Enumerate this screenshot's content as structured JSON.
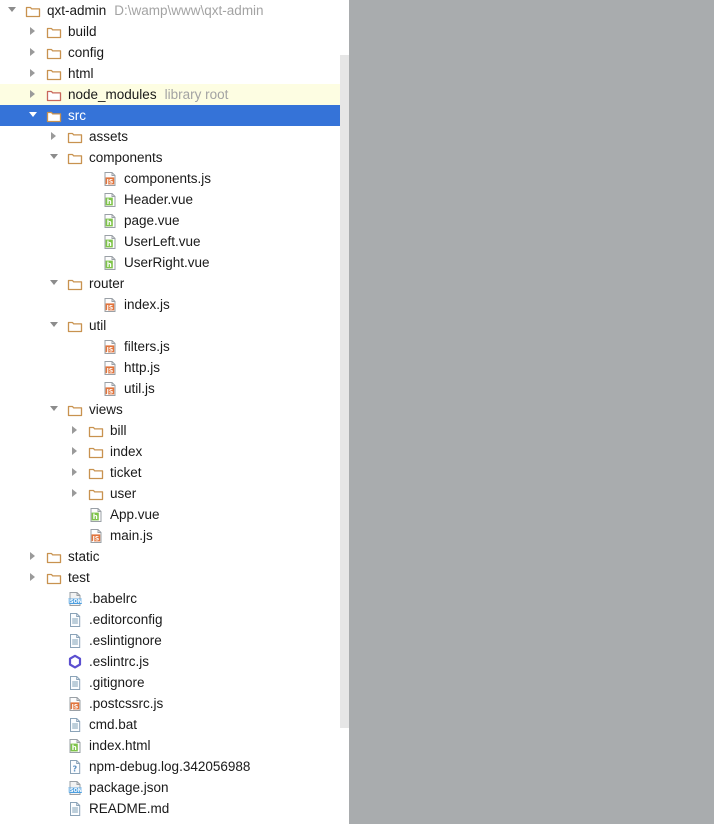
{
  "window": {
    "tool_window": "Project",
    "right_panel_color": "#a9acae",
    "selection_color": "#3573d8",
    "excluded_highlight_color": "#fdfde2"
  },
  "scrollbar": {
    "track_color": "#e6e6e6",
    "orientation": "vertical"
  },
  "tree": {
    "nodes": [
      {
        "label": "qxt-admin",
        "hint": "D:\\wamp\\www\\qxt-admin",
        "depth": 0,
        "icon": "folder-module-icon",
        "state": "expanded",
        "selected": false,
        "highlight": false
      },
      {
        "label": "build",
        "hint": "",
        "depth": 1,
        "icon": "folder-icon",
        "state": "collapsed",
        "selected": false,
        "highlight": false
      },
      {
        "label": "config",
        "hint": "",
        "depth": 1,
        "icon": "folder-icon",
        "state": "collapsed",
        "selected": false,
        "highlight": false
      },
      {
        "label": "html",
        "hint": "",
        "depth": 1,
        "icon": "folder-icon",
        "state": "collapsed",
        "selected": false,
        "highlight": false
      },
      {
        "label": "node_modules",
        "hint": "library root",
        "depth": 1,
        "icon": "folder-excluded-icon",
        "state": "collapsed",
        "selected": false,
        "highlight": true
      },
      {
        "label": "src",
        "hint": "",
        "depth": 1,
        "icon": "folder-source-icon",
        "state": "expanded",
        "selected": true,
        "highlight": false
      },
      {
        "label": "assets",
        "hint": "",
        "depth": 2,
        "icon": "folder-icon",
        "state": "collapsed",
        "selected": false,
        "highlight": false
      },
      {
        "label": "components",
        "hint": "",
        "depth": 2,
        "icon": "folder-icon",
        "state": "expanded",
        "selected": false,
        "highlight": false
      },
      {
        "label": "components.js",
        "hint": "",
        "depth": 4,
        "icon": "js-file-icon",
        "state": "leaf",
        "selected": false,
        "highlight": false
      },
      {
        "label": "Header.vue",
        "hint": "",
        "depth": 4,
        "icon": "vue-file-icon",
        "state": "leaf",
        "selected": false,
        "highlight": false
      },
      {
        "label": "page.vue",
        "hint": "",
        "depth": 4,
        "icon": "vue-file-icon",
        "state": "leaf",
        "selected": false,
        "highlight": false
      },
      {
        "label": "UserLeft.vue",
        "hint": "",
        "depth": 4,
        "icon": "vue-file-icon",
        "state": "leaf",
        "selected": false,
        "highlight": false
      },
      {
        "label": "UserRight.vue",
        "hint": "",
        "depth": 4,
        "icon": "vue-file-icon",
        "state": "leaf",
        "selected": false,
        "highlight": false
      },
      {
        "label": "router",
        "hint": "",
        "depth": 2,
        "icon": "folder-icon",
        "state": "expanded",
        "selected": false,
        "highlight": false
      },
      {
        "label": "index.js",
        "hint": "",
        "depth": 4,
        "icon": "js-file-icon",
        "state": "leaf",
        "selected": false,
        "highlight": false
      },
      {
        "label": "util",
        "hint": "",
        "depth": 2,
        "icon": "folder-icon",
        "state": "expanded",
        "selected": false,
        "highlight": false
      },
      {
        "label": "filters.js",
        "hint": "",
        "depth": 4,
        "icon": "js-file-icon",
        "state": "leaf",
        "selected": false,
        "highlight": false
      },
      {
        "label": "http.js",
        "hint": "",
        "depth": 4,
        "icon": "js-file-icon",
        "state": "leaf",
        "selected": false,
        "highlight": false
      },
      {
        "label": "util.js",
        "hint": "",
        "depth": 4,
        "icon": "js-file-icon",
        "state": "leaf",
        "selected": false,
        "highlight": false
      },
      {
        "label": "views",
        "hint": "",
        "depth": 2,
        "icon": "folder-icon",
        "state": "expanded",
        "selected": false,
        "highlight": false
      },
      {
        "label": "bill",
        "hint": "",
        "depth": 3,
        "icon": "folder-icon",
        "state": "collapsed",
        "selected": false,
        "highlight": false
      },
      {
        "label": "index",
        "hint": "",
        "depth": 3,
        "icon": "folder-icon",
        "state": "collapsed",
        "selected": false,
        "highlight": false
      },
      {
        "label": "ticket",
        "hint": "",
        "depth": 3,
        "icon": "folder-icon",
        "state": "collapsed",
        "selected": false,
        "highlight": false
      },
      {
        "label": "user",
        "hint": "",
        "depth": 3,
        "icon": "folder-icon",
        "state": "collapsed",
        "selected": false,
        "highlight": false
      },
      {
        "label": "App.vue",
        "hint": "",
        "depth": 3,
        "icon": "vue-file-icon",
        "state": "leaf",
        "selected": false,
        "highlight": false
      },
      {
        "label": "main.js",
        "hint": "",
        "depth": 3,
        "icon": "js-file-icon",
        "state": "leaf",
        "selected": false,
        "highlight": false
      },
      {
        "label": "static",
        "hint": "",
        "depth": 1,
        "icon": "folder-icon",
        "state": "collapsed",
        "selected": false,
        "highlight": false
      },
      {
        "label": "test",
        "hint": "",
        "depth": 1,
        "icon": "folder-icon",
        "state": "collapsed",
        "selected": false,
        "highlight": false
      },
      {
        "label": ".babelrc",
        "hint": "",
        "depth": 2,
        "icon": "json-file-icon",
        "state": "leaf",
        "selected": false,
        "highlight": false
      },
      {
        "label": ".editorconfig",
        "hint": "",
        "depth": 2,
        "icon": "text-file-icon",
        "state": "leaf",
        "selected": false,
        "highlight": false
      },
      {
        "label": ".eslintignore",
        "hint": "",
        "depth": 2,
        "icon": "text-file-icon",
        "state": "leaf",
        "selected": false,
        "highlight": false
      },
      {
        "label": ".eslintrc.js",
        "hint": "",
        "depth": 2,
        "icon": "eslint-file-icon",
        "state": "leaf",
        "selected": false,
        "highlight": false
      },
      {
        "label": ".gitignore",
        "hint": "",
        "depth": 2,
        "icon": "text-file-icon",
        "state": "leaf",
        "selected": false,
        "highlight": false
      },
      {
        "label": ".postcssrc.js",
        "hint": "",
        "depth": 2,
        "icon": "js-file-icon",
        "state": "leaf",
        "selected": false,
        "highlight": false
      },
      {
        "label": "cmd.bat",
        "hint": "",
        "depth": 2,
        "icon": "text-file-icon",
        "state": "leaf",
        "selected": false,
        "highlight": false
      },
      {
        "label": "index.html",
        "hint": "",
        "depth": 2,
        "icon": "html-file-icon",
        "state": "leaf",
        "selected": false,
        "highlight": false
      },
      {
        "label": "npm-debug.log.342056988",
        "hint": "",
        "depth": 2,
        "icon": "unknown-file-icon",
        "state": "leaf",
        "selected": false,
        "highlight": false
      },
      {
        "label": "package.json",
        "hint": "",
        "depth": 2,
        "icon": "json-file-icon",
        "state": "leaf",
        "selected": false,
        "highlight": false
      },
      {
        "label": "README.md",
        "hint": "",
        "depth": 2,
        "icon": "text-file-icon",
        "state": "leaf",
        "selected": false,
        "highlight": false
      }
    ]
  }
}
